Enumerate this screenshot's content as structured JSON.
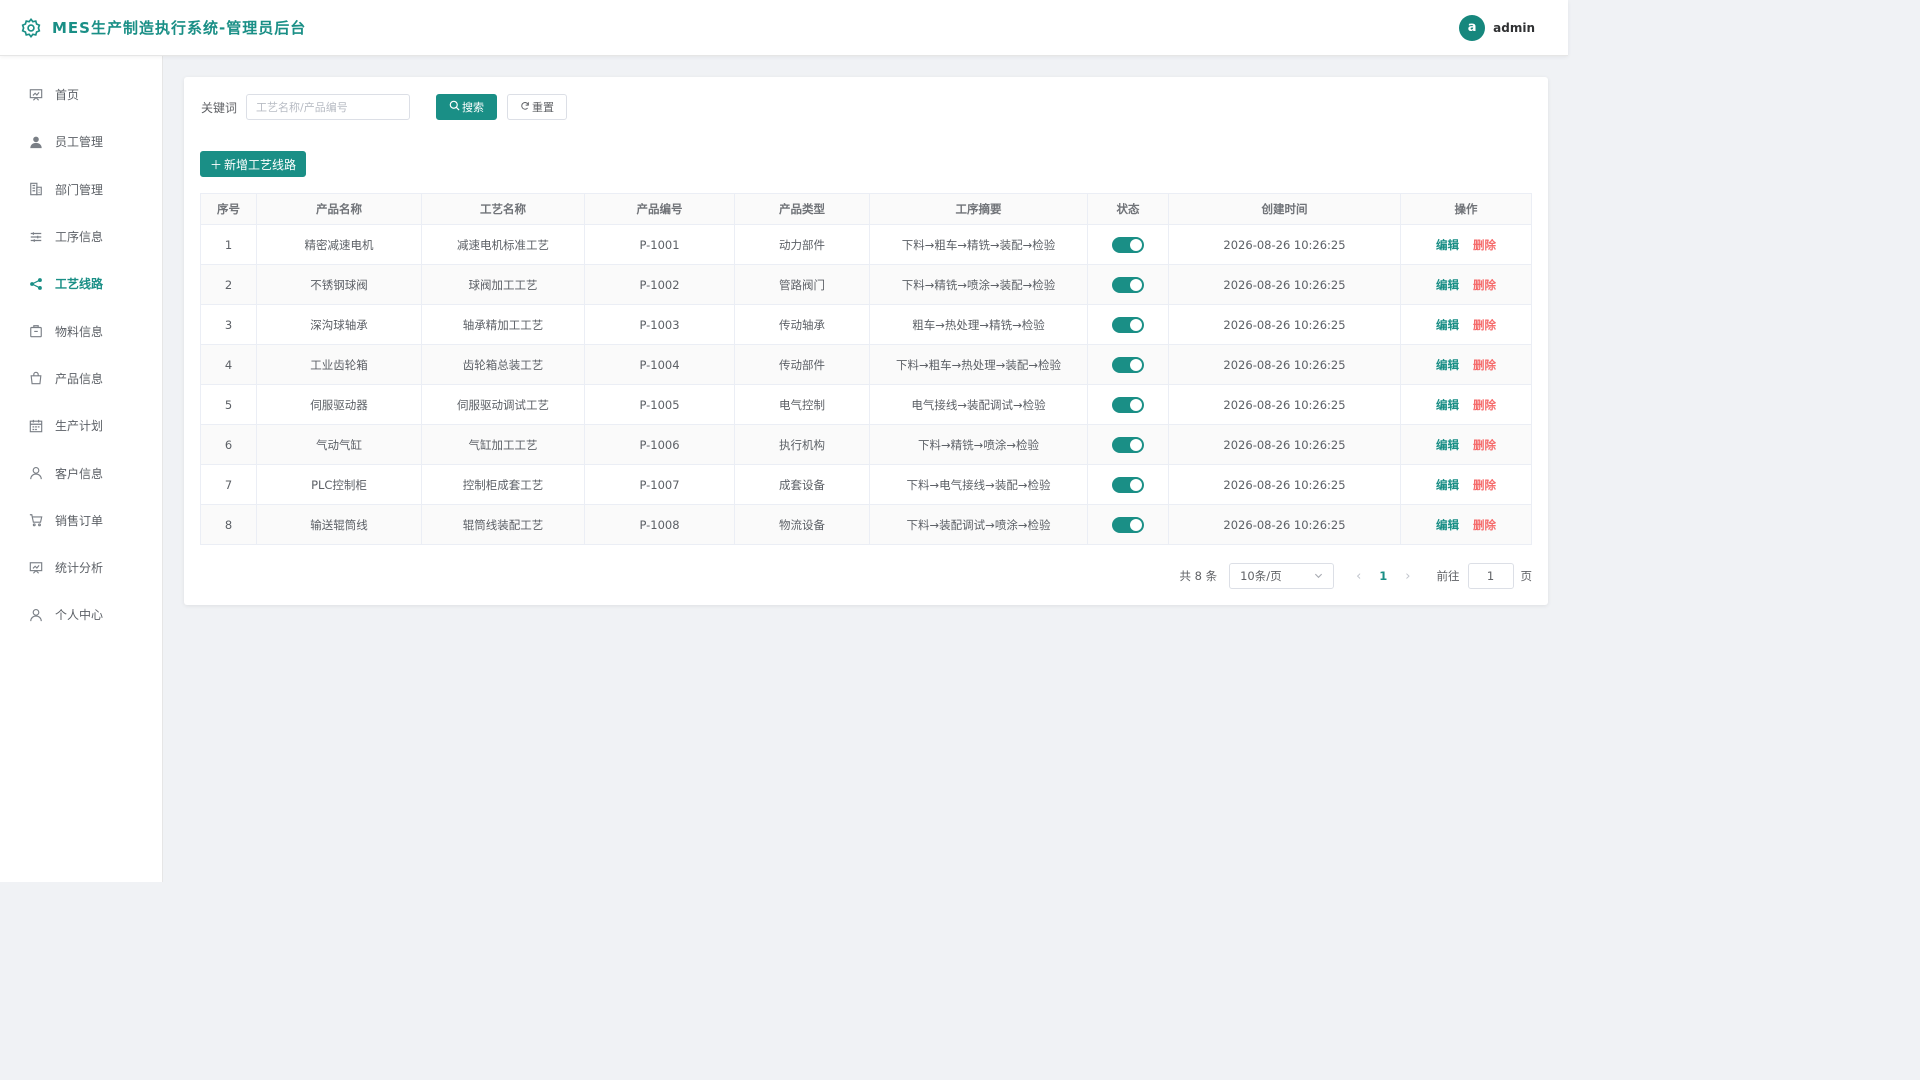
{
  "header": {
    "title": "MES生产制造执行系统-管理员后台",
    "avatar_letter": "a",
    "username": "admin"
  },
  "sidebar": {
    "items": [
      {
        "label": "首页",
        "icon": "dashboard-icon"
      },
      {
        "label": "员工管理",
        "icon": "user-icon"
      },
      {
        "label": "部门管理",
        "icon": "office-building-icon"
      },
      {
        "label": "工序信息",
        "icon": "sliders-icon"
      },
      {
        "label": "工艺线路",
        "icon": "share-icon",
        "active": true
      },
      {
        "label": "物料信息",
        "icon": "box-icon"
      },
      {
        "label": "产品信息",
        "icon": "shopping-bag-icon"
      },
      {
        "label": "生产计划",
        "icon": "calendar-icon"
      },
      {
        "label": "客户信息",
        "icon": "user-outline-icon"
      },
      {
        "label": "销售订单",
        "icon": "shopping-cart-icon"
      },
      {
        "label": "统计分析",
        "icon": "data-board-icon"
      },
      {
        "label": "个人中心",
        "icon": "user-outline-icon"
      }
    ]
  },
  "search": {
    "label": "关键词",
    "placeholder": "工艺名称/产品编号",
    "value": "",
    "search_label": "搜索",
    "reset_label": "重置"
  },
  "add_button_label": "新增工艺线路",
  "table": {
    "columns": [
      "序号",
      "产品名称",
      "工艺名称",
      "产品编号",
      "产品类型",
      "工序摘要",
      "状态",
      "创建时间",
      "操作"
    ],
    "rows": [
      {
        "index": "1",
        "product": "精密减速电机",
        "process": "减速电机标准工艺",
        "code": "P-1001",
        "type": "动力部件",
        "summary": "下料→粗车→精铣→装配→检验",
        "enabled": true,
        "created": "2026-08-26 10:26:25"
      },
      {
        "index": "2",
        "product": "不锈钢球阀",
        "process": "球阀加工工艺",
        "code": "P-1002",
        "type": "管路阀门",
        "summary": "下料→精铣→喷涂→装配→检验",
        "enabled": true,
        "created": "2026-08-26 10:26:25"
      },
      {
        "index": "3",
        "product": "深沟球轴承",
        "process": "轴承精加工工艺",
        "code": "P-1003",
        "type": "传动轴承",
        "summary": "粗车→热处理→精铣→检验",
        "enabled": true,
        "created": "2026-08-26 10:26:25"
      },
      {
        "index": "4",
        "product": "工业齿轮箱",
        "process": "齿轮箱总装工艺",
        "code": "P-1004",
        "type": "传动部件",
        "summary": "下料→粗车→热处理→装配→检验",
        "enabled": true,
        "created": "2026-08-26 10:26:25"
      },
      {
        "index": "5",
        "product": "伺服驱动器",
        "process": "伺服驱动调试工艺",
        "code": "P-1005",
        "type": "电气控制",
        "summary": "电气接线→装配调试→检验",
        "enabled": true,
        "created": "2026-08-26 10:26:25"
      },
      {
        "index": "6",
        "product": "气动气缸",
        "process": "气缸加工工艺",
        "code": "P-1006",
        "type": "执行机构",
        "summary": "下料→精铣→喷涂→检验",
        "enabled": true,
        "created": "2026-08-26 10:26:25"
      },
      {
        "index": "7",
        "product": "PLC控制柜",
        "process": "控制柜成套工艺",
        "code": "P-1007",
        "type": "成套设备",
        "summary": "下料→电气接线→装配→检验",
        "enabled": true,
        "created": "2026-08-26 10:26:25"
      },
      {
        "index": "8",
        "product": "输送辊筒线",
        "process": "辊筒线装配工艺",
        "code": "P-1008",
        "type": "物流设备",
        "summary": "下料→装配调试→喷涂→检验",
        "enabled": true,
        "created": "2026-08-26 10:26:25"
      }
    ],
    "edit_label": "编辑",
    "delete_label": "删除"
  },
  "pagination": {
    "total_text": "共 8 条",
    "page_size": "10条/页",
    "current_page": "1",
    "goto_label": "前往",
    "goto_value": "1",
    "page_suffix": "页"
  },
  "colors": {
    "accent": "#1a8f86",
    "danger": "#f56c6c",
    "background": "#f0f2f5"
  }
}
